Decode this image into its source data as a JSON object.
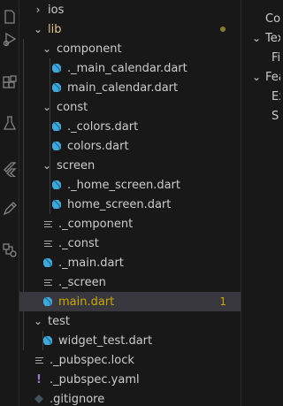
{
  "activity": [
    "explorer-icon",
    "run-debug-icon",
    "extensions-icon",
    "testing-icon",
    "flutter-icon",
    "pencil-icon",
    "remote-explorer-icon"
  ],
  "tree": [
    {
      "label": "ios",
      "kind": "folder",
      "expanded": false
    },
    {
      "label": "lib",
      "kind": "folder",
      "expanded": true,
      "modified_dot": true
    },
    {
      "label": "component",
      "kind": "folder",
      "expanded": true
    },
    {
      "label": "._main_calendar.dart",
      "kind": "dart"
    },
    {
      "label": "main_calendar.dart",
      "kind": "dart"
    },
    {
      "label": "const",
      "kind": "folder",
      "expanded": true
    },
    {
      "label": "._colors.dart",
      "kind": "dart"
    },
    {
      "label": "colors.dart",
      "kind": "dart"
    },
    {
      "label": "screen",
      "kind": "folder",
      "expanded": true
    },
    {
      "label": "._home_screen.dart",
      "kind": "dart"
    },
    {
      "label": "home_screen.dart",
      "kind": "dart"
    },
    {
      "label": "._component",
      "kind": "file"
    },
    {
      "label": "._const",
      "kind": "file"
    },
    {
      "label": "._main.dart",
      "kind": "dart"
    },
    {
      "label": "._screen",
      "kind": "file"
    },
    {
      "label": "main.dart",
      "kind": "dart",
      "badge": "1"
    },
    {
      "label": "test",
      "kind": "folder",
      "expanded": true
    },
    {
      "label": "widget_test.dart",
      "kind": "dart"
    },
    {
      "label": "._pubspec.lock",
      "kind": "file"
    },
    {
      "label": "._pubspec.yaml",
      "kind": "yaml"
    },
    {
      "label": ".gitignore",
      "kind": "git"
    }
  ],
  "outline": [
    {
      "label": "Co",
      "chevron": ""
    },
    {
      "label": "Tex",
      "chevron": "⌄"
    },
    {
      "label": "Fi",
      "chevron": ""
    },
    {
      "label": "Fea",
      "chevron": "⌄"
    },
    {
      "label": "Ex",
      "chevron": ""
    },
    {
      "label": "S",
      "chevron": ""
    }
  ],
  "colors": {
    "background": "#181818",
    "selection": "#37373d",
    "warning": "#cca700",
    "dart_icon": "#40a7d8",
    "yaml_icon": "#a074c4"
  }
}
